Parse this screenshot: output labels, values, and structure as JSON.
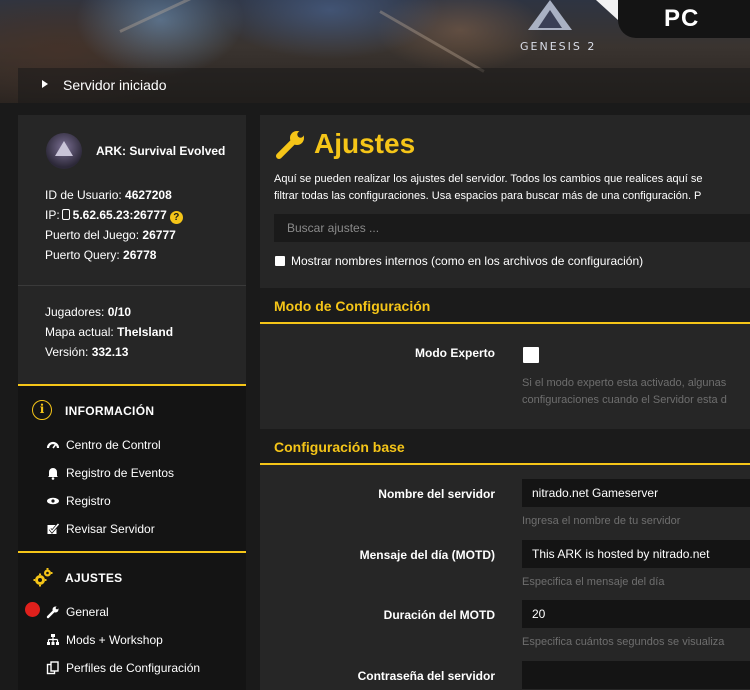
{
  "banner": {
    "logo_text": "ARK",
    "logo_subtitle": "GENESIS 2",
    "platform": "PC",
    "status": "Servidor iniciado"
  },
  "sidebar": {
    "server_name": "ARK: Survival Evolved",
    "user_id_label": "ID de Usuario:",
    "user_id": "4627208",
    "ip_label": "IP:",
    "ip": "5.62.65.23:26777",
    "game_port_label": "Puerto del Juego:",
    "game_port": "26777",
    "query_port_label": "Puerto Query:",
    "query_port": "26778",
    "players_label": "Jugadores:",
    "players": "0/10",
    "map_label": "Mapa actual:",
    "map": "TheIsland",
    "version_label": "Versión:",
    "version": "332.13",
    "info_section": {
      "title": "INFORMACIÓN",
      "items": [
        {
          "label": "Centro de Control",
          "icon": "gauge-icon"
        },
        {
          "label": "Registro de Eventos",
          "icon": "bell-icon"
        },
        {
          "label": "Registro",
          "icon": "eye-icon"
        },
        {
          "label": "Revisar Servidor",
          "icon": "check-square-icon"
        }
      ]
    },
    "settings_section": {
      "title": "AJUSTES",
      "items": [
        {
          "label": "General",
          "icon": "wrench-icon"
        },
        {
          "label": "Mods + Workshop",
          "icon": "sitemap-icon"
        },
        {
          "label": "Perfiles de Configuración",
          "icon": "copy-icon"
        }
      ]
    }
  },
  "main": {
    "title": "Ajustes",
    "description_line1": "Aquí se pueden realizar los ajustes del servidor. Todos los cambios que realices aquí se",
    "description_line2": "filtrar todas las configuraciones. Usa espacios para buscar más de una configuración. P",
    "search_placeholder": "Buscar ajustes ...",
    "show_internal_names": "Mostrar nombres internos (como en los archivos de configuración)",
    "config_mode_section": "Modo de Configuración",
    "expert_mode_label": "Modo Experto",
    "expert_mode_hint_line1": "Si el modo experto esta activado, algunas",
    "expert_mode_hint_line2": "configuraciones cuando el Servidor esta d",
    "base_config_section": "Configuración base",
    "server_name_label": "Nombre del servidor",
    "server_name_value": "nitrado.net Gameserver",
    "server_name_hint": "Ingresa el nombre de tu servidor",
    "motd_label": "Mensaje del día (MOTD)",
    "motd_value": "This ARK is hosted by nitrado.net",
    "motd_hint": "Especifica el mensaje del día",
    "motd_duration_label": "Duración del MOTD",
    "motd_duration_value": "20",
    "motd_duration_hint": "Especifica cuántos segundos se visualiza",
    "password_label": "Contraseña del servidor"
  },
  "colors": {
    "accent": "#f5c518",
    "panel": "#262626",
    "nav_bg": "#141414",
    "alert_dot": "#e0201c"
  }
}
